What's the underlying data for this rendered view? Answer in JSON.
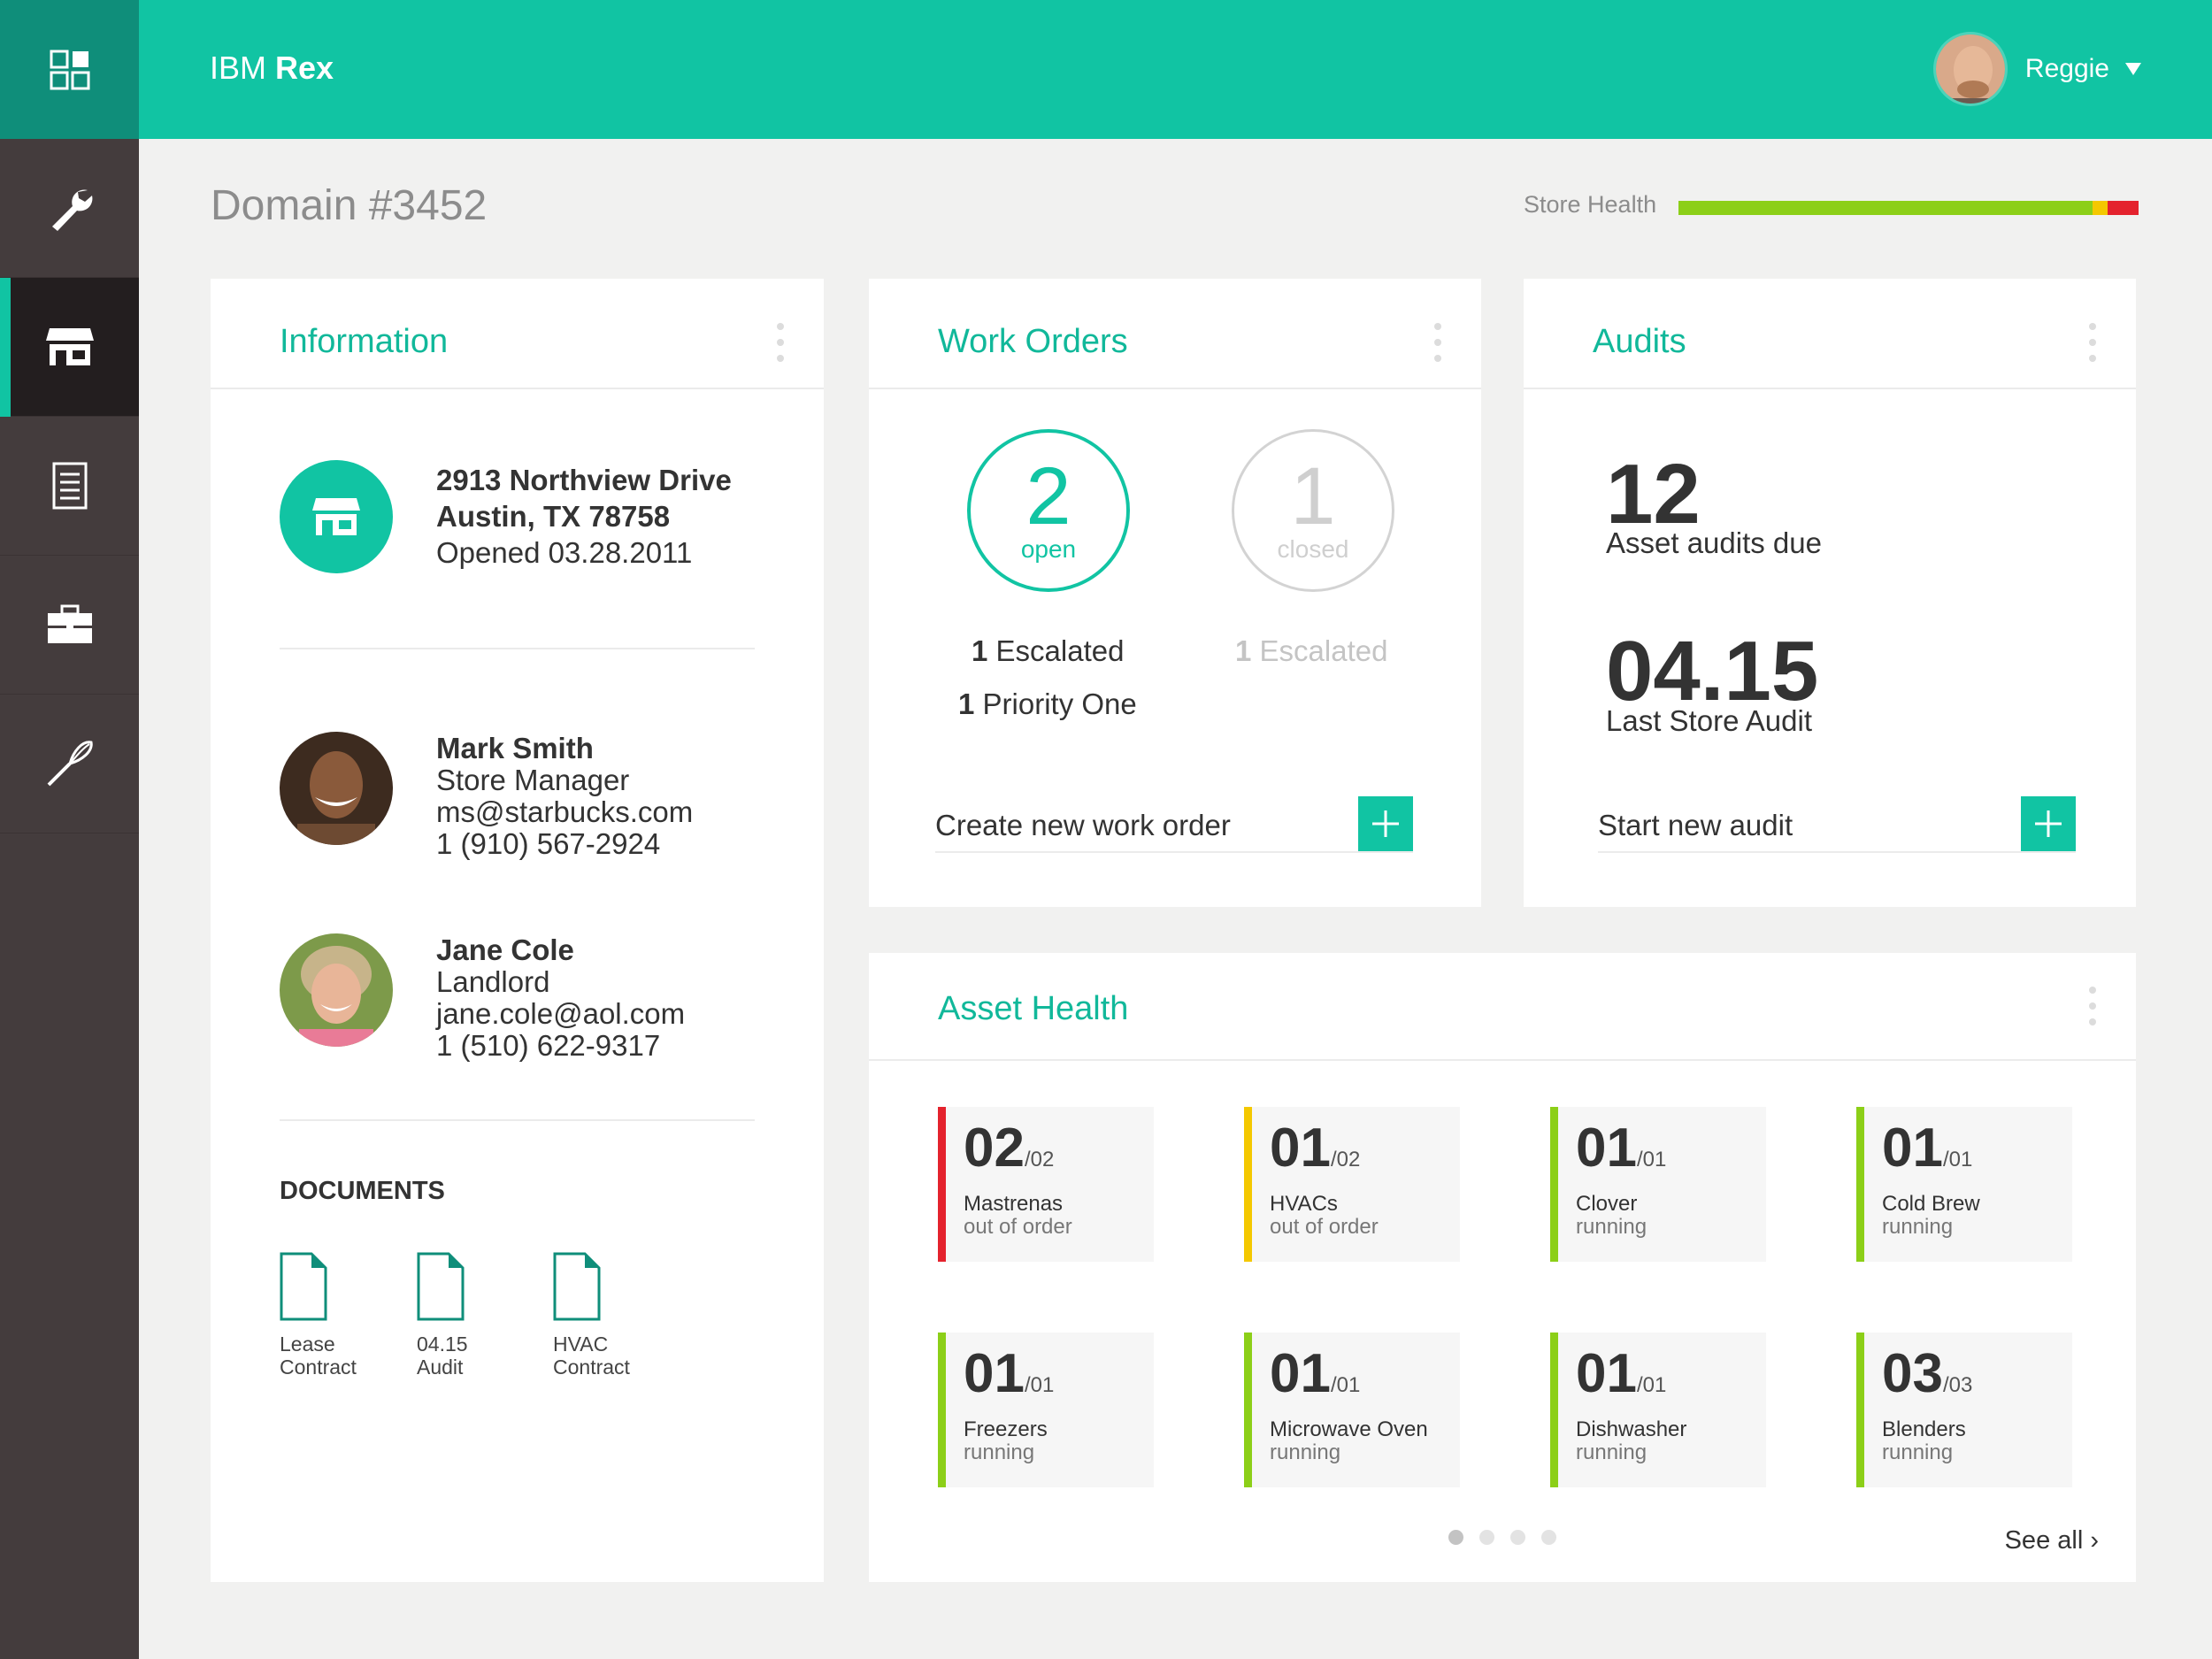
{
  "header": {
    "app_brand": "IBM",
    "app_name": "Rex",
    "user_name": "Reggie"
  },
  "sidebar": {
    "items": [
      {
        "icon": "dashboard-icon"
      },
      {
        "icon": "wrench-icon"
      },
      {
        "icon": "store-icon",
        "active": true
      },
      {
        "icon": "clipboard-icon"
      },
      {
        "icon": "briefcase-icon"
      },
      {
        "icon": "whisk-icon"
      }
    ]
  },
  "page": {
    "title": "Domain #3452",
    "store_health_label": "Store Health"
  },
  "store_health": {
    "good": 0.9,
    "warning": 0.033,
    "critical": 0.067,
    "colors": {
      "good": "#8ccf18",
      "warning": "#f4c800",
      "critical": "#e4222d"
    }
  },
  "information": {
    "title": "Information",
    "address_line1": "2913 Northview Drive",
    "address_line2": "Austin, TX 78758",
    "opened": "Opened 03.28.2011",
    "contacts": [
      {
        "name": "Mark Smith",
        "role": "Store Manager",
        "email": "ms@starbucks.com",
        "phone": "1 (910) 567-2924"
      },
      {
        "name": "Jane Cole",
        "role": "Landlord",
        "email": "jane.cole@aol.com",
        "phone": "1 (510) 622-9317"
      }
    ],
    "documents_title": "DOCUMENTS",
    "documents": [
      {
        "line1": "Lease",
        "line2": "Contract"
      },
      {
        "line1": "04.15",
        "line2": "Audit"
      },
      {
        "line1": "HVAC",
        "line2": "Contract"
      }
    ]
  },
  "work_orders": {
    "title": "Work Orders",
    "open_count": "2",
    "open_label": "open",
    "closed_count": "1",
    "closed_label": "closed",
    "open_escalated_n": "1",
    "open_escalated_label": "Escalated",
    "open_priority_n": "1",
    "open_priority_label": "Priority One",
    "closed_escalated_n": "1",
    "closed_escalated_label": "Escalated",
    "action_label": "Create new work order"
  },
  "audits": {
    "title": "Audits",
    "due_count": "12",
    "due_label": "Asset audits due",
    "last_date": "04.15",
    "last_label": "Last Store Audit",
    "action_label": "Start new audit"
  },
  "asset_health": {
    "title": "Asset Health",
    "see_all": "See all",
    "tiles": [
      {
        "count": "02",
        "total": "/02",
        "name": "Mastrenas",
        "status": "out of order",
        "level": "red"
      },
      {
        "count": "01",
        "total": "/02",
        "name": "HVACs",
        "status": "out of order",
        "level": "yellow"
      },
      {
        "count": "01",
        "total": "/01",
        "name": "Clover",
        "status": "running",
        "level": "green"
      },
      {
        "count": "01",
        "total": "/01",
        "name": "Cold Brew",
        "status": "running",
        "level": "green"
      },
      {
        "count": "01",
        "total": "/01",
        "name": "Freezers",
        "status": "running",
        "level": "green"
      },
      {
        "count": "01",
        "total": "/01",
        "name": "Microwave Oven",
        "status": "running",
        "level": "green"
      },
      {
        "count": "01",
        "total": "/01",
        "name": "Dishwasher",
        "status": "running",
        "level": "green"
      },
      {
        "count": "03",
        "total": "/03",
        "name": "Blenders",
        "status": "running",
        "level": "green"
      }
    ],
    "page_count": 4,
    "current_page": 1
  }
}
